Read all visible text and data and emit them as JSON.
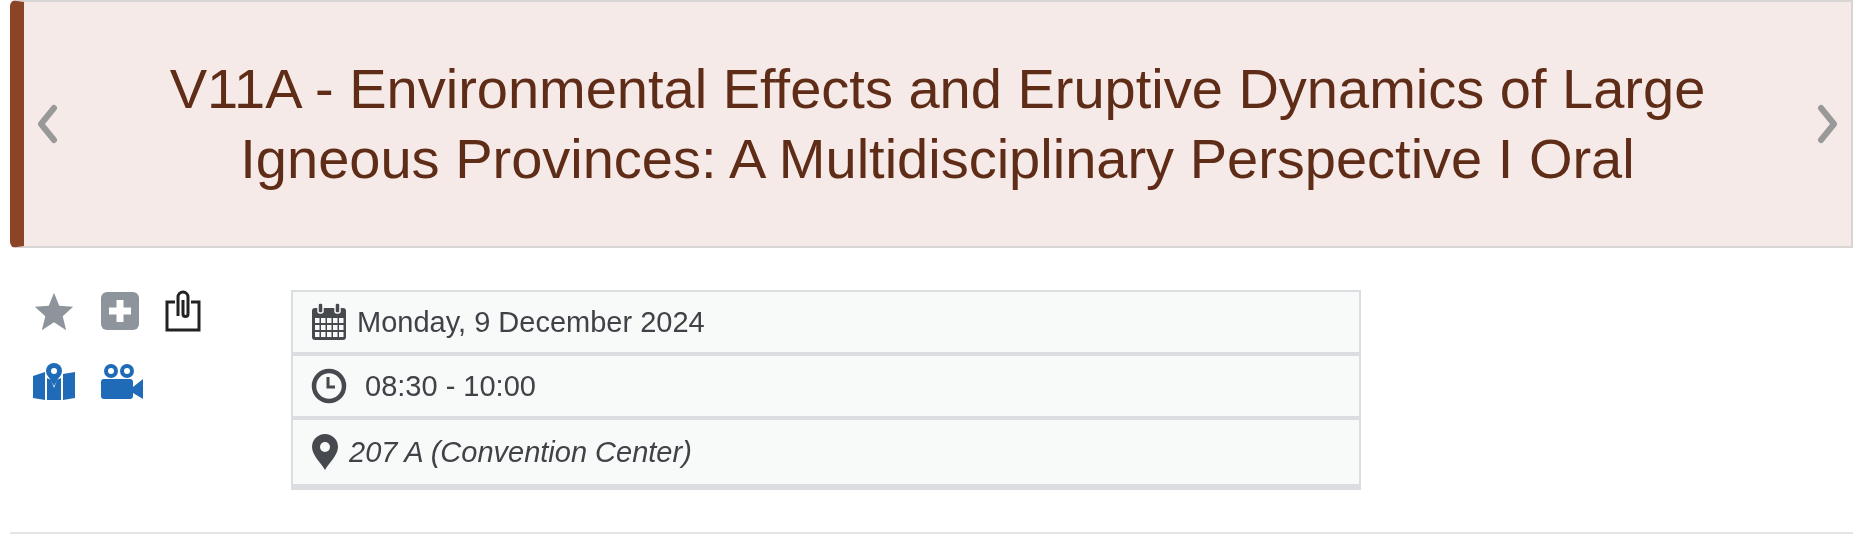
{
  "session": {
    "title": "V11A - Environmental Effects and Eruptive Dynamics of Large Igneous Provinces: A Multidisciplinary Perspective I Oral"
  },
  "details": [
    {
      "kind": "date",
      "text": "Monday, 9 December 2024"
    },
    {
      "kind": "time",
      "text": "08:30 - 10:00"
    },
    {
      "kind": "location",
      "text": "207 A (Convention Center)"
    }
  ]
}
